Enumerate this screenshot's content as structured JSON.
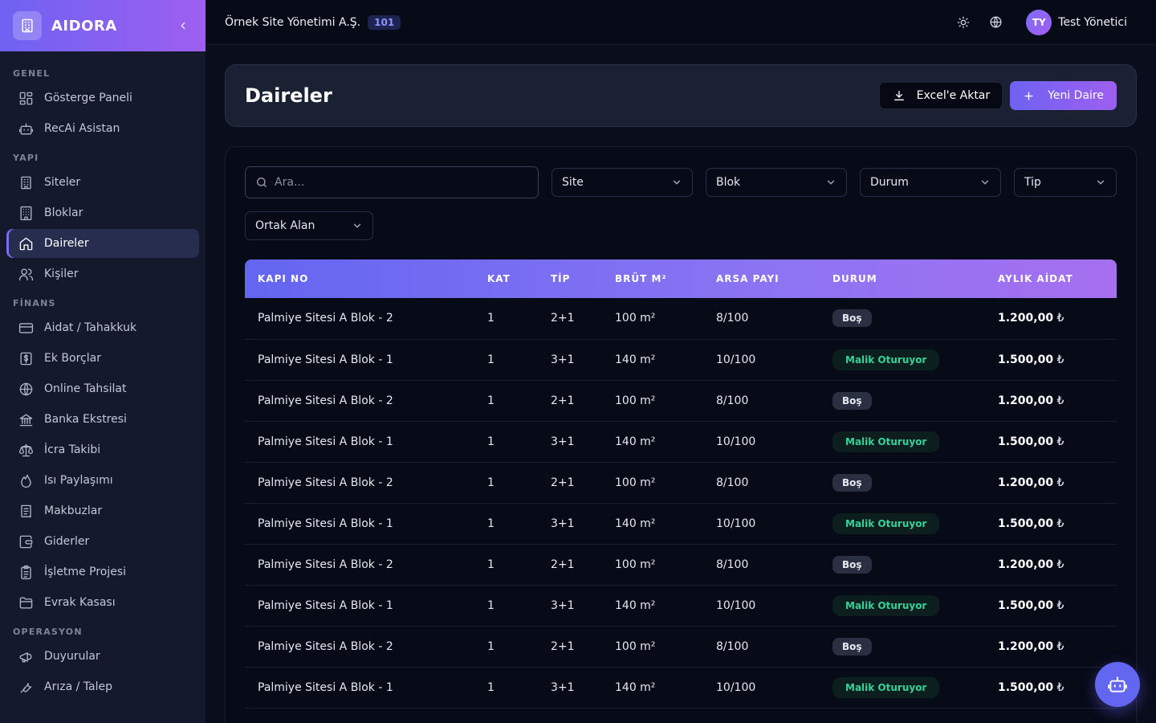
{
  "brand": {
    "name": "AIDORA"
  },
  "sidebar": {
    "sections": [
      {
        "title": "GENEL",
        "items": [
          {
            "label": "Gösterge Paneli",
            "icon": "dashboard-icon"
          },
          {
            "label": "RecAi Asistan",
            "icon": "bot-icon"
          }
        ]
      },
      {
        "title": "YAPI",
        "items": [
          {
            "label": "Siteler",
            "icon": "building-icon"
          },
          {
            "label": "Bloklar",
            "icon": "block-icon"
          },
          {
            "label": "Daireler",
            "icon": "home-icon",
            "active": true
          },
          {
            "label": "Kişiler",
            "icon": "users-icon"
          }
        ]
      },
      {
        "title": "FİNANS",
        "items": [
          {
            "label": "Aidat / Tahakkuk",
            "icon": "credit-card-icon"
          },
          {
            "label": "Ek Borçlar",
            "icon": "dollar-icon"
          },
          {
            "label": "Online Tahsilat",
            "icon": "globe-icon"
          },
          {
            "label": "Banka Ekstresi",
            "icon": "bank-icon"
          },
          {
            "label": "İcra Takibi",
            "icon": "scale-icon"
          },
          {
            "label": "Isı Paylaşımı",
            "icon": "flame-icon"
          },
          {
            "label": "Makbuzlar",
            "icon": "receipt-icon"
          },
          {
            "label": "Giderler",
            "icon": "wallet-icon"
          },
          {
            "label": "İşletme Projesi",
            "icon": "clipboard-icon"
          },
          {
            "label": "Evrak Kasası",
            "icon": "folder-icon"
          }
        ]
      },
      {
        "title": "OPERASYON",
        "items": [
          {
            "label": "Duyurular",
            "icon": "megaphone-icon"
          },
          {
            "label": "Arıza / Talep",
            "icon": "wrench-icon"
          }
        ]
      }
    ]
  },
  "topbar": {
    "org_name": "Örnek Site Yönetimi A.Ş.",
    "org_badge": "101",
    "user_initials": "TY",
    "user_name": "Test Yönetici"
  },
  "header": {
    "title": "Daireler",
    "export_label": "Excel'e Aktar",
    "new_label": "Yeni Daire"
  },
  "filters": {
    "search_placeholder": "Ara...",
    "site": "Site",
    "blok": "Blok",
    "durum": "Durum",
    "tip": "Tip",
    "ortak_alan": "Ortak Alan"
  },
  "table": {
    "columns": [
      "KAPI NO",
      "KAT",
      "TİP",
      "BRÜT M²",
      "ARSA PAYI",
      "DURUM",
      "AYLIK AİDAT"
    ],
    "currency": "₺",
    "rows": [
      [
        "Palmiye Sitesi A Blok - 2",
        "1",
        "2+1",
        "100 m²",
        "8/100",
        "Boş",
        "1.200,00"
      ],
      [
        "Palmiye Sitesi A Blok - 1",
        "1",
        "3+1",
        "140 m²",
        "10/100",
        "Malik Oturuyor",
        "1.500,00"
      ],
      [
        "Palmiye Sitesi A Blok - 2",
        "1",
        "2+1",
        "100 m²",
        "8/100",
        "Boş",
        "1.200,00"
      ],
      [
        "Palmiye Sitesi A Blok - 1",
        "1",
        "3+1",
        "140 m²",
        "10/100",
        "Malik Oturuyor",
        "1.500,00"
      ],
      [
        "Palmiye Sitesi A Blok - 2",
        "1",
        "2+1",
        "100 m²",
        "8/100",
        "Boş",
        "1.200,00"
      ],
      [
        "Palmiye Sitesi A Blok - 1",
        "1",
        "3+1",
        "140 m²",
        "10/100",
        "Malik Oturuyor",
        "1.500,00"
      ],
      [
        "Palmiye Sitesi A Blok - 2",
        "1",
        "2+1",
        "100 m²",
        "8/100",
        "Boş",
        "1.200,00"
      ],
      [
        "Palmiye Sitesi A Blok - 1",
        "1",
        "3+1",
        "140 m²",
        "10/100",
        "Malik Oturuyor",
        "1.500,00"
      ],
      [
        "Palmiye Sitesi A Blok - 2",
        "1",
        "2+1",
        "100 m²",
        "8/100",
        "Boş",
        "1.200,00"
      ],
      [
        "Palmiye Sitesi A Blok - 1",
        "1",
        "3+1",
        "140 m²",
        "10/100",
        "Malik Oturuyor",
        "1.500,00"
      ]
    ]
  },
  "colors": {
    "accent": "#6366f1",
    "accent_2": "#9d5ff0",
    "success_text": "#34d399"
  }
}
